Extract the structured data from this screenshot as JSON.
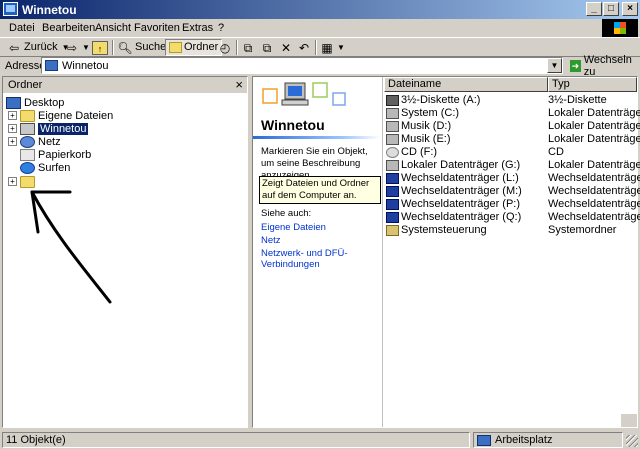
{
  "window": {
    "title": "Winnetou",
    "buttons": {
      "minimize": "_",
      "maximize": "□",
      "close": "×"
    }
  },
  "menu": {
    "items": [
      "Datei",
      "Bearbeiten",
      "Ansicht",
      "Favoriten",
      "Extras",
      "?"
    ]
  },
  "toolbar": {
    "back_label": "Zurück",
    "search_label": "Suchen",
    "folders_label": "Ordner"
  },
  "address": {
    "label": "Adresse",
    "value": "Winnetou",
    "go_label": "Wechseln zu"
  },
  "folders_pane": {
    "title": "Ordner",
    "close_glyph": "×",
    "tree": [
      {
        "label": "Desktop",
        "icon": "desktop-icon"
      },
      {
        "label": "Eigene Dateien",
        "icon": "folder-icon"
      },
      {
        "label": "Winnetou",
        "icon": "computer-icon",
        "selected": true
      },
      {
        "label": "Netz",
        "icon": "network-icon"
      },
      {
        "label": "Papierkorb",
        "icon": "recycle-bin-icon"
      },
      {
        "label": "Surfen",
        "icon": "internet-explorer-icon"
      },
      {
        "label": "",
        "icon": "folder-icon"
      }
    ]
  },
  "webview": {
    "title": "Winnetou",
    "description": "Markieren Sie ein Objekt, um seine Beschreibung anzuzeigen.",
    "tip": "Zeigt Dateien und Ordner auf dem Computer an.",
    "see_also": "Siehe auch:",
    "links": [
      "Eigene Dateien",
      "Netz",
      "Netzwerk- und DFÜ-Verbindungen"
    ]
  },
  "filelist": {
    "columns": [
      "Dateiname",
      "Typ"
    ],
    "rows": [
      {
        "name": "3½-Diskette (A:)",
        "type": "3½-Diskette",
        "icon": "floppy-icon"
      },
      {
        "name": "System (C:)",
        "type": "Lokaler Datenträger",
        "icon": "drive-icon"
      },
      {
        "name": "Musik (D:)",
        "type": "Lokaler Datenträger",
        "icon": "drive-icon"
      },
      {
        "name": "Musik (E:)",
        "type": "Lokaler Datenträger",
        "icon": "drive-icon"
      },
      {
        "name": "CD (F:)",
        "type": "CD",
        "icon": "cd-icon"
      },
      {
        "name": "Lokaler Datenträger (G:)",
        "type": "Lokaler Datenträger",
        "icon": "drive-icon"
      },
      {
        "name": "Wechseldatenträger (L:)",
        "type": "Wechseldatenträger",
        "icon": "removable-drive-icon"
      },
      {
        "name": "Wechseldatenträger (M:)",
        "type": "Wechseldatenträger",
        "icon": "removable-drive-icon"
      },
      {
        "name": "Wechseldatenträger (P:)",
        "type": "Wechseldatenträger",
        "icon": "removable-drive-icon"
      },
      {
        "name": "Wechseldatenträger (Q:)",
        "type": "Wechseldatenträger",
        "icon": "removable-drive-icon"
      },
      {
        "name": "Systemsteuerung",
        "type": "Systemordner",
        "icon": "control-panel-icon"
      }
    ]
  },
  "statusbar": {
    "count": "11 Objekt(e)",
    "location": "Arbeitsplatz"
  }
}
